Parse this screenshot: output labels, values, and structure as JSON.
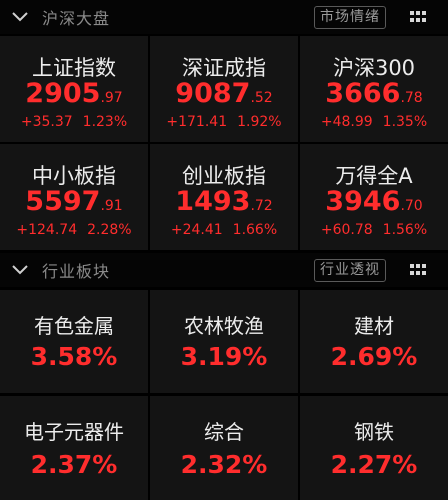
{
  "market": {
    "title": "沪深大盘",
    "button_label": "市场情绪",
    "indices": [
      {
        "name": "上证指数",
        "value_int": "2905",
        "value_dec": ".97",
        "change": "+35.37",
        "pct": "1.23%"
      },
      {
        "name": "深证成指",
        "value_int": "9087",
        "value_dec": ".52",
        "change": "+171.41",
        "pct": "1.92%"
      },
      {
        "name": "沪深300",
        "value_int": "3666",
        "value_dec": ".78",
        "change": "+48.99",
        "pct": "1.35%"
      },
      {
        "name": "中小板指",
        "value_int": "5597",
        "value_dec": ".91",
        "change": "+124.74",
        "pct": "2.28%"
      },
      {
        "name": "创业板指",
        "value_int": "1493",
        "value_dec": ".72",
        "change": "+24.41",
        "pct": "1.66%"
      },
      {
        "name": "万得全A",
        "value_int": "3946",
        "value_dec": ".70",
        "change": "+60.78",
        "pct": "1.56%"
      }
    ]
  },
  "industry": {
    "title": "行业板块",
    "button_label": "行业透视",
    "sectors": [
      {
        "name": "有色金属",
        "pct": "3.58%"
      },
      {
        "name": "农林牧渔",
        "pct": "3.19%"
      },
      {
        "name": "建材",
        "pct": "2.69%"
      },
      {
        "name": "电子元器件",
        "pct": "2.37%"
      },
      {
        "name": "综合",
        "pct": "2.32%"
      },
      {
        "name": "钢铁",
        "pct": "2.27%"
      }
    ]
  },
  "colors": {
    "up": "#ff2d2d",
    "background": "#000000",
    "cell": "#141414"
  },
  "icons": {
    "collapse": "chevron-down-icon",
    "menu": "grid-menu-icon"
  }
}
